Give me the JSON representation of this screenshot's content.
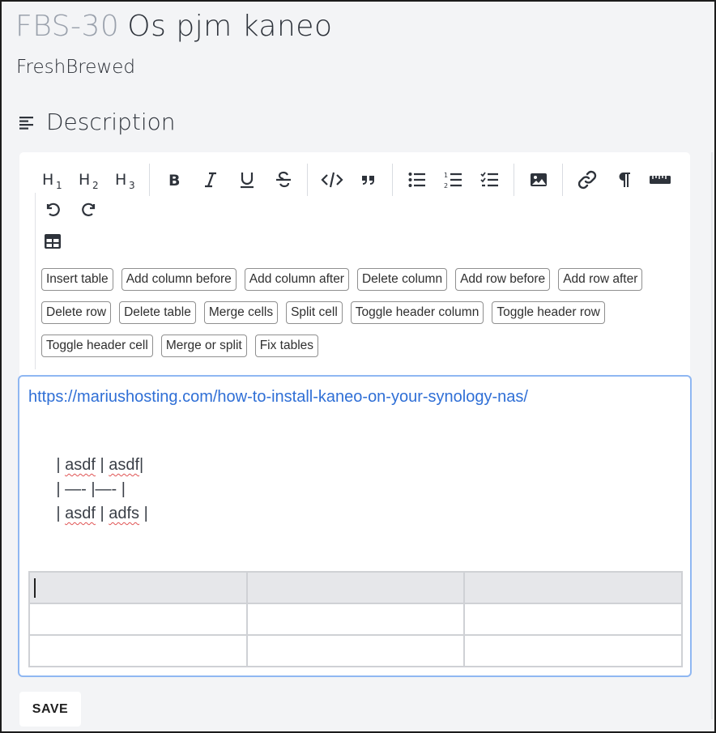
{
  "issue": {
    "key": "FBS-30",
    "title": "Os pjm kaneo",
    "project": "FreshBrewed"
  },
  "description": {
    "heading": "Description",
    "icon": "align-left-icon"
  },
  "toolbar": {
    "groups": [
      [
        "heading-1-icon",
        "heading-2-icon",
        "heading-3-icon"
      ],
      [
        "bold-icon",
        "italic-icon",
        "underline-icon",
        "strikethrough-icon"
      ],
      [
        "code-icon",
        "quote-icon"
      ],
      [
        "bullet-list-icon",
        "ordered-list-icon",
        "task-list-icon"
      ],
      [
        "image-icon"
      ],
      [
        "link-icon",
        "paragraph-icon",
        "ruler-icon"
      ]
    ],
    "row2": [
      "undo-icon",
      "redo-icon"
    ],
    "row3": [
      "table-icon"
    ]
  },
  "table_buttons": [
    "Insert table",
    "Add column before",
    "Add column after",
    "Delete column",
    "Add row before",
    "Add row after",
    "Delete row",
    "Delete table",
    "Merge cells",
    "Split cell",
    "Toggle header column",
    "Toggle header row",
    "Toggle header cell",
    "Merge or split",
    "Fix tables"
  ],
  "editor": {
    "link": "https://mariushosting.com/how-to-install-kaneo-on-your-synology-nas/",
    "lines": [
      [
        "| ",
        "asdf",
        " | ",
        "asdf",
        "|"
      ],
      [
        "| —- |—- |"
      ],
      [
        "| ",
        "asdf",
        " | ",
        "adfs",
        " |"
      ]
    ],
    "table": {
      "rows": 3,
      "cols": 3
    }
  },
  "save_label": "SAVE"
}
